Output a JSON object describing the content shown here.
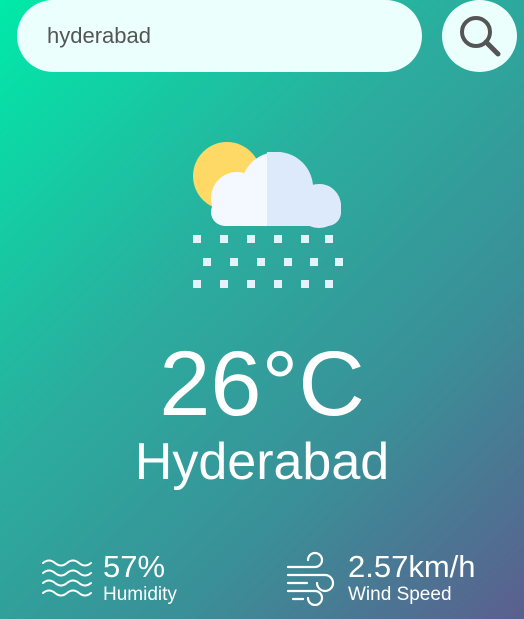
{
  "search": {
    "value": "hyderabad",
    "button_icon": "search-icon"
  },
  "weather": {
    "icon": "snow-cloud-sun-icon",
    "temperature": "26°C",
    "city": "Hyderabad"
  },
  "details": {
    "humidity": {
      "value": "57%",
      "label": "Humidity",
      "icon": "humidity-waves-icon"
    },
    "wind": {
      "value": "2.57km/h",
      "label": "Wind Speed",
      "icon": "wind-icon"
    }
  },
  "colors": {
    "gradient_start": "#00eaa9",
    "gradient_end": "#5b5f8e",
    "search_bg": "#ebfffc",
    "text": "#ffffff"
  }
}
